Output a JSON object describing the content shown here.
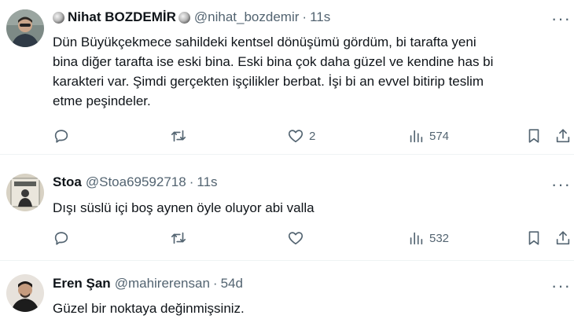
{
  "tweets": [
    {
      "name": "Nihat BOZDEMİR",
      "handle": "@nihat_bozdemir",
      "separator": "·",
      "time": "11s",
      "text_lines": [
        "Dün Büyükçekmece sahildeki kentsel dönüşümü gördüm, bi tarafta yeni",
        "bina diğer tarafta ise eski bina. Eski bina çok daha güzel ve kendine has bi",
        "karakteri var. Şimdi gerçekten işçilikler berbat. İşi bi an evvel bitirip teslim",
        "etme peşindeler."
      ],
      "likes": "2",
      "views": "574"
    },
    {
      "name": "Stoa",
      "handle": "@Stoa69592718",
      "separator": "·",
      "time": "11s",
      "text_lines": [
        "Dışı süslü içi boş aynen öyle oluyor abi valla"
      ],
      "likes": "",
      "views": "532"
    },
    {
      "name": "Eren Şan",
      "handle": "@mahirerensan",
      "separator": "·",
      "time": "54d",
      "text_lines": [
        "Güzel bir noktaya değinmişsiniz."
      ]
    }
  ],
  "more_glyph": "···",
  "icons": [
    "reply-icon",
    "retweet-icon",
    "like-icon",
    "views-icon",
    "bookmark-icon",
    "share-icon",
    "more-icon",
    "moon-emoji-icon"
  ]
}
